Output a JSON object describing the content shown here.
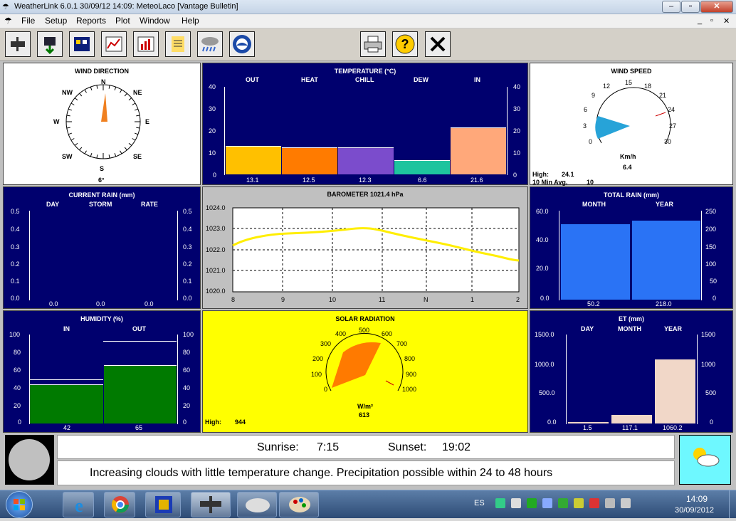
{
  "window": {
    "title": "WeatherLink 6.0.1  30/09/12  14:09: MeteoLaco   [Vantage Bulletin]"
  },
  "menu": [
    "File",
    "Setup",
    "Reports",
    "Plot",
    "Window",
    "Help"
  ],
  "wind_direction": {
    "title": "WIND DIRECTION",
    "compass": [
      "N",
      "NE",
      "E",
      "SE",
      "S",
      "SW",
      "W",
      "NW"
    ],
    "value": "6°",
    "degrees": 6
  },
  "temperature": {
    "title": "TEMPERATURE  (°C)",
    "columns": [
      "OUT",
      "HEAT",
      "CHILL",
      "DEW",
      "IN"
    ],
    "values": [
      "13.1",
      "12.5",
      "12.3",
      "6.6",
      "21.6"
    ],
    "ticks": [
      "40",
      "30",
      "20",
      "10",
      "0"
    ],
    "colors": [
      "#ffc000",
      "#ff7b00",
      "#7b4ccc",
      "#1ec49e",
      "#ffa87a"
    ],
    "nums": [
      13.1,
      12.5,
      12.3,
      6.6,
      21.6
    ],
    "max": 40
  },
  "wind_speed": {
    "title": "WIND SPEED",
    "ticks": [
      "0",
      "3",
      "6",
      "9",
      "12",
      "15",
      "18",
      "21",
      "24",
      "27",
      "30"
    ],
    "unit": "Km/h",
    "value": "6.4",
    "high_label": "High:",
    "high": "24.1",
    "avg_label": "10 Min Avg.",
    "avg": "10"
  },
  "current_rain": {
    "title": "CURRENT RAIN  (mm)",
    "columns": [
      "DAY",
      "STORM",
      "RATE"
    ],
    "values": [
      "0.0",
      "0.0",
      "0.0"
    ],
    "ticks": [
      "0.5",
      "0.4",
      "0.3",
      "0.2",
      "0.1",
      "0.0"
    ]
  },
  "barometer": {
    "title": "BAROMETER 1021.4 hPa",
    "yticks": [
      "1024.0",
      "1023.0",
      "1022.0",
      "1021.0",
      "1020.0"
    ],
    "xticks": [
      "8",
      "9",
      "10",
      "11",
      "N",
      "1",
      "2"
    ]
  },
  "total_rain": {
    "title": "TOTAL RAIN  (mm)",
    "columns": [
      "MONTH",
      "YEAR"
    ],
    "values": [
      "50.2",
      "218.0"
    ],
    "lticks": [
      "60.0",
      "40.0",
      "20.0",
      "0.0"
    ],
    "rticks": [
      "250",
      "200",
      "150",
      "100",
      "50",
      "0"
    ]
  },
  "humidity": {
    "title": "HUMIDITY  (%)",
    "columns": [
      "IN",
      "OUT"
    ],
    "values": [
      "42",
      "65"
    ],
    "ticks": [
      "100",
      "80",
      "60",
      "40",
      "20",
      "0"
    ]
  },
  "solar": {
    "title": "SOLAR RADIATION",
    "ticks": [
      "0",
      "100",
      "200",
      "300",
      "400",
      "500",
      "600",
      "700",
      "800",
      "900",
      "1000"
    ],
    "unit": "W/m²",
    "value": "613",
    "high_label": "High:",
    "high": "944"
  },
  "et": {
    "title": "ET  (mm)",
    "columns": [
      "DAY",
      "MONTH",
      "YEAR"
    ],
    "values": [
      "1.5",
      "117.1",
      "1060.2"
    ],
    "lticks": [
      "1500.0",
      "1000.0",
      "500.0",
      "0.0"
    ],
    "rticks": [
      "1500",
      "1000",
      "500",
      "0"
    ]
  },
  "bulletin": {
    "sunrise_label": "Sunrise:",
    "sunrise": "7:15",
    "sunset_label": "Sunset:",
    "sunset": "19:02",
    "forecast": "Increasing clouds with little temperature change.  Precipitation possible within 24 to 48 hours"
  },
  "tray": {
    "lang": "ES",
    "time": "14:09",
    "date": "30/09/2012"
  }
}
